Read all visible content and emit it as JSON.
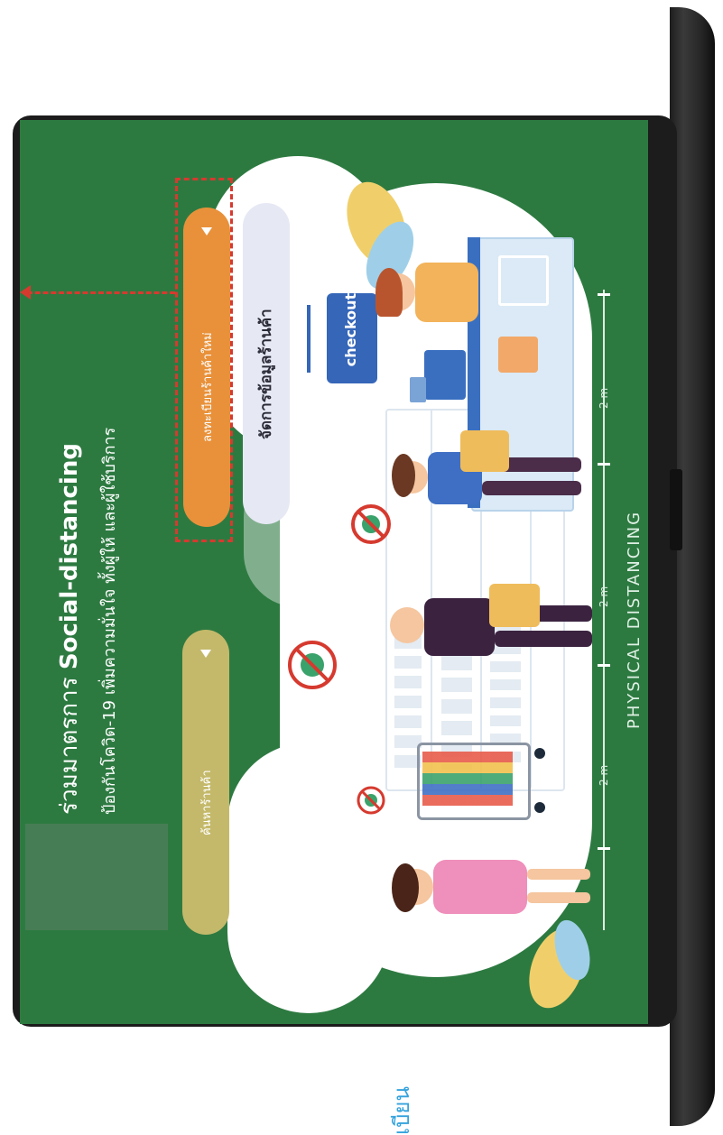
{
  "screen": {
    "headline_prefix": "ร่วมมาตรการ ",
    "headline_bold": "Social-distancing",
    "subheadline": "ป้องกันโควิด-19 เพิ่มความมั่นใจ ทั้งผู้ให้ และผู้ใช้บริการ",
    "buttons": {
      "find_shop": "ค้นหาร้านค้า",
      "register_shop": "ลงทะเบียนร้านค้าใหม่",
      "manage_shop": "จัดการข้อมูลร้านค้า"
    },
    "checkout_sign": "checkout",
    "distance_label": "2 m",
    "physical_distancing": "PHYSICAL DISTANCING"
  },
  "below_laptop_text": "เบียน",
  "colors": {
    "screen_green": "#2d7a41",
    "find_shop_button": "#c4b96a",
    "register_shop_button": "#e8913a",
    "manage_shop_button": "#e6e8f4",
    "highlight_dash": "#d63a2f",
    "checkout_sign": "#3566b8",
    "caption_blue": "#35a3dd"
  },
  "icons": [
    "play-arrow-icon",
    "virus-prohibited-icon",
    "shopping-cart-icon",
    "shopping-basket-icon",
    "arrow-up-icon"
  ]
}
